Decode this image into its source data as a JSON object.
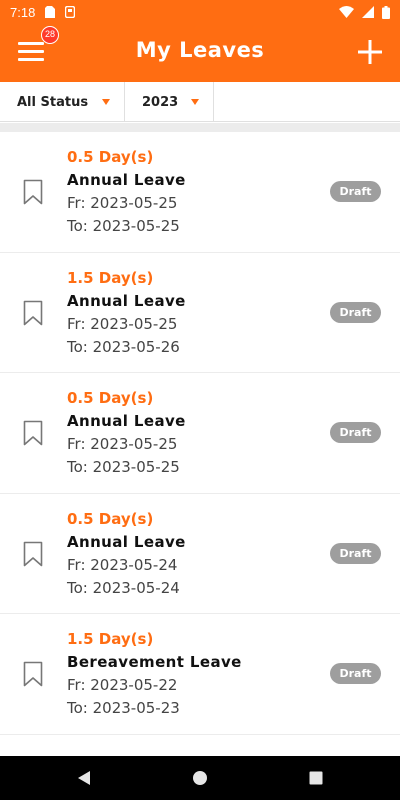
{
  "status_bar": {
    "time": "7:18"
  },
  "app_bar": {
    "title": "My Leaves",
    "notification_count": "28"
  },
  "filters": {
    "status": "All Status",
    "year": "2023"
  },
  "leaves": [
    {
      "days": "0.5 Day(s)",
      "type": "Annual Leave",
      "from": "Fr: 2023-05-25",
      "to": "To: 2023-05-25",
      "status": "Draft"
    },
    {
      "days": "1.5 Day(s)",
      "type": "Annual Leave",
      "from": "Fr: 2023-05-25",
      "to": "To: 2023-05-26",
      "status": "Draft"
    },
    {
      "days": "0.5 Day(s)",
      "type": "Annual Leave",
      "from": "Fr: 2023-05-25",
      "to": "To: 2023-05-25",
      "status": "Draft"
    },
    {
      "days": "0.5 Day(s)",
      "type": "Annual Leave",
      "from": "Fr: 2023-05-24",
      "to": "To: 2023-05-24",
      "status": "Draft"
    },
    {
      "days": "1.5 Day(s)",
      "type": "Bereavement Leave",
      "from": "Fr: 2023-05-22",
      "to": "To: 2023-05-23",
      "status": "Draft"
    }
  ],
  "colors": {
    "accent": "#ff6d12",
    "badge": "#ff3a2a",
    "draft": "#9e9e9e"
  },
  "icons": {
    "menu": "hamburger-icon",
    "add": "plus-icon",
    "bookmark": "bookmark-outline-icon",
    "back": "triangle-back-icon",
    "home": "circle-home-icon",
    "recent": "square-recents-icon"
  }
}
